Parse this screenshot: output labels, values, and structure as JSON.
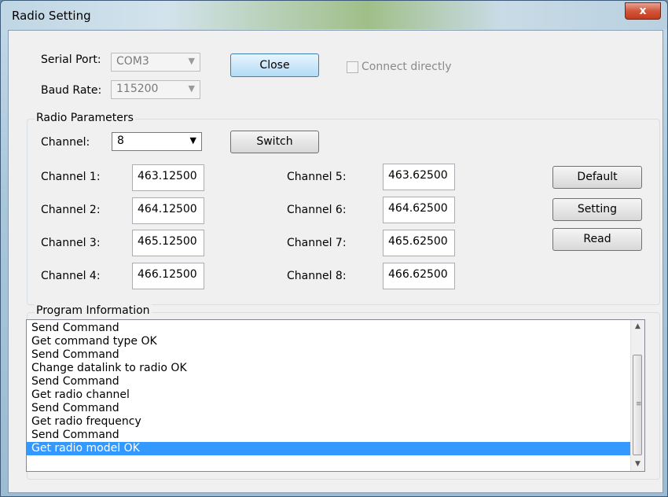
{
  "window": {
    "title": "Radio Setting",
    "close_glyph": "x"
  },
  "connection": {
    "serial_port_label": "Serial Port:",
    "serial_port_value": "COM3",
    "baud_rate_label": "Baud Rate:",
    "baud_rate_value": "115200",
    "close_button": "Close",
    "connect_directly_label": "Connect directly",
    "connect_directly_checked": false
  },
  "radio_parameters": {
    "group_title": "Radio Parameters",
    "channel_label": "Channel:",
    "channel_value": "8",
    "switch_button": "Switch",
    "channels": [
      {
        "label": "Channel 1:",
        "value": "463.12500"
      },
      {
        "label": "Channel 2:",
        "value": "464.12500"
      },
      {
        "label": "Channel 3:",
        "value": "465.12500"
      },
      {
        "label": "Channel 4:",
        "value": "466.12500"
      },
      {
        "label": "Channel 5:",
        "value": "463.62500"
      },
      {
        "label": "Channel 6:",
        "value": "464.62500"
      },
      {
        "label": "Channel 7:",
        "value": "465.62500"
      },
      {
        "label": "Channel 8:",
        "value": "466.62500"
      }
    ],
    "default_button": "Default",
    "setting_button": "Setting",
    "read_button": "Read"
  },
  "program_information": {
    "group_title": "Program Information",
    "log": [
      "Send Command",
      "Get command type OK",
      "Send Command",
      "Change datalink to radio OK",
      "Send Command",
      "Get radio channel",
      "Send Command",
      "Get radio frequency",
      "Send Command",
      "Get radio model OK"
    ],
    "selected_index": 9
  },
  "colors": {
    "selection": "#3399ff",
    "dialog_bg": "#f0f0f0",
    "close_button": "#c63a1c"
  }
}
